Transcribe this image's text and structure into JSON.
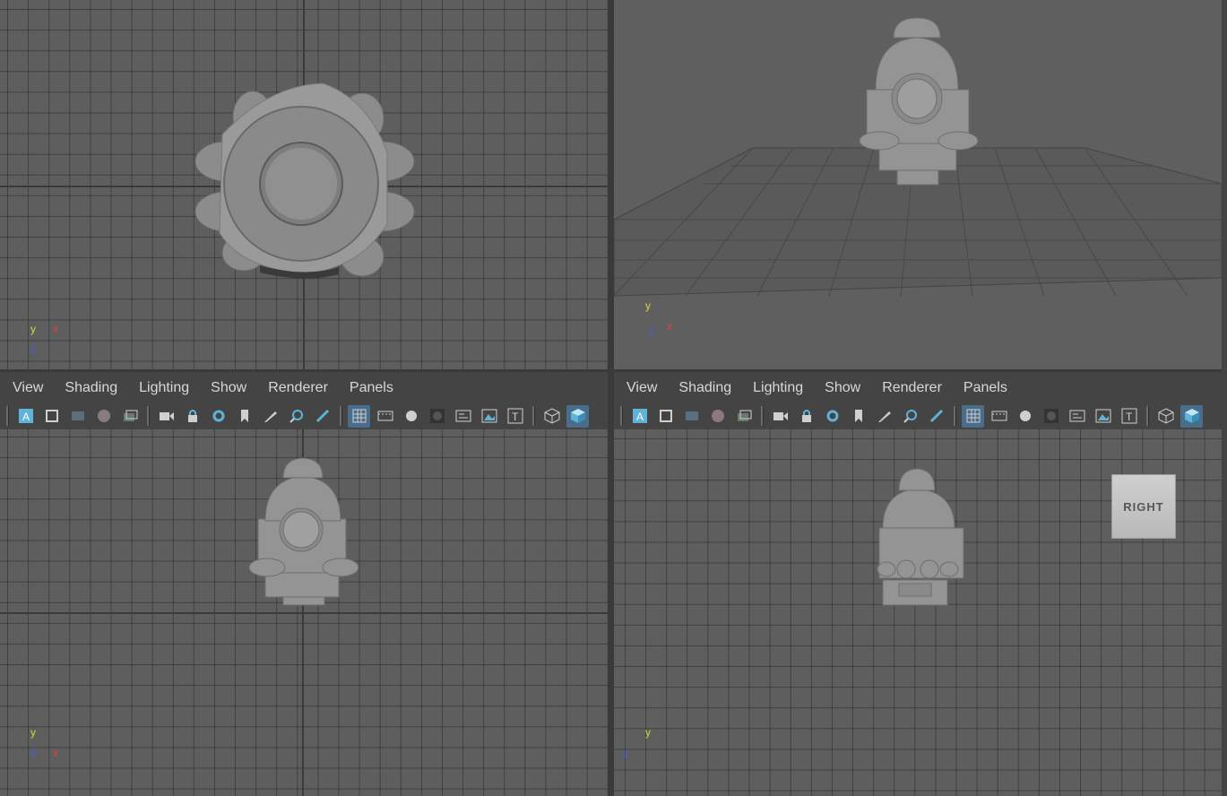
{
  "menus": {
    "left": [
      "View",
      "Shading",
      "Lighting",
      "Show",
      "Renderer",
      "Panels"
    ],
    "right": [
      "View",
      "Shading",
      "Lighting",
      "Show",
      "Renderer",
      "Panels"
    ]
  },
  "toolbar_icons": [
    "a-select-icon",
    "frame-icon",
    "film-gate-icon",
    "sphere-icon",
    "layers-icon",
    "camera-icon",
    "lock-camera-icon",
    "camera-attributes-icon",
    "bookmark-icon",
    "grease-pencil-icon",
    "pan-zoom-icon",
    "paint-icon",
    "grid-icon",
    "resolution-gate-icon",
    "shaded-icon",
    "wireframe-icon",
    "hud-icon",
    "image-plane-icon",
    "text-icon",
    "wire-cube-icon",
    "shaded-cube-icon"
  ],
  "viewcube_label": "RIGHT",
  "axes": {
    "top": {
      "a": "y",
      "b": "x",
      "c": "z"
    },
    "persp": {
      "a": "y",
      "b": "x",
      "c": "z"
    },
    "front": {
      "a": "y",
      "b": "x",
      "c": "z"
    },
    "side": {
      "a": "y",
      "b": "z"
    }
  },
  "colors": {
    "accent": "#5fb3d9",
    "axis_x": "#e04040",
    "axis_y": "#d8d840",
    "axis_z": "#4060e0",
    "background": "#5e5e5e"
  }
}
